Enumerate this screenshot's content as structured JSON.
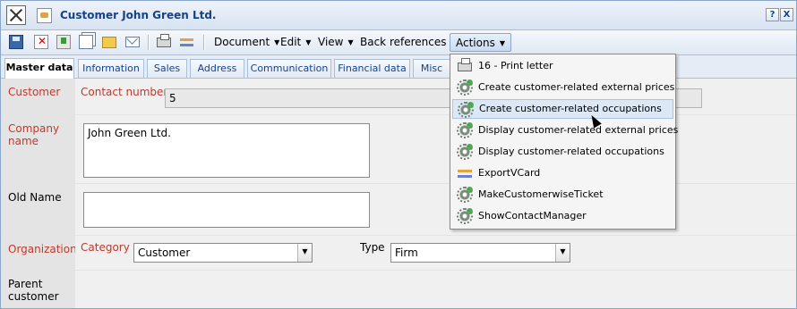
{
  "window": {
    "title": "Customer John Green Ltd.",
    "help_button": "?",
    "close_button": "X"
  },
  "toolbar": {
    "icons": [
      "save-icon",
      "delete-icon",
      "export-icon",
      "copy-icon",
      "folder-icon",
      "mail-icon",
      "print-icon",
      "references-icon"
    ],
    "menus": [
      "Document",
      "Edit",
      "View",
      "Back references",
      "Actions"
    ],
    "active_menu": "Actions"
  },
  "tabs": [
    {
      "label": "Master data",
      "active": true
    },
    {
      "label": "Information"
    },
    {
      "label": "Sales"
    },
    {
      "label": "Address"
    },
    {
      "label": "Communication"
    },
    {
      "label": "Financial data"
    },
    {
      "label": "Misc"
    }
  ],
  "form": {
    "customer": {
      "label": "Customer",
      "contact_label": "Contact number",
      "contact_value": "5"
    },
    "company": {
      "label": "Company name",
      "value": "John Green Ltd."
    },
    "old_name": {
      "label": "Old Name",
      "value": ""
    },
    "organization": {
      "label": "Organization",
      "category_label": "Category",
      "category_value": "Customer",
      "type_label": "Type",
      "type_value": "Firm"
    },
    "parent": {
      "label": "Parent customer"
    }
  },
  "actions_menu": {
    "items": [
      {
        "label": "16 - Print letter",
        "icon": "printer-icon"
      },
      {
        "label": "Create customer-related external prices",
        "icon": "gear-icon"
      },
      {
        "label": "Create customer-related occupations",
        "icon": "gear-icon",
        "hover": true
      },
      {
        "label": "Display customer-related external prices",
        "icon": "gear-icon"
      },
      {
        "label": "Display customer-related occupations",
        "icon": "gear-icon"
      },
      {
        "label": "ExportVCard",
        "icon": "swap-icon"
      },
      {
        "label": "MakeCustomerwiseTicket",
        "icon": "gear-icon"
      },
      {
        "label": "ShowContactManager",
        "icon": "gear-icon"
      }
    ]
  },
  "colors": {
    "title": "#15428b",
    "required_label": "#c0392b",
    "menu_hover": "#dde8f6"
  }
}
